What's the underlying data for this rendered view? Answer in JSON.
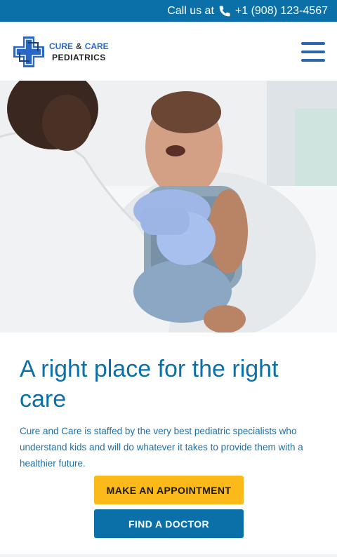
{
  "topbar": {
    "call_label": "Call us at",
    "phone": "+1 (908) 123-4567",
    "icon": "phone-icon"
  },
  "header": {
    "logo": {
      "word1": "CURE",
      "amp": "&",
      "word2": "CARE",
      "word3": "PEDIATRICS",
      "icon": "medical-cross-icon"
    },
    "menu_icon": "hamburger-menu-icon"
  },
  "hero": {
    "image": "doctor applying bandage to smiling toddler's arm"
  },
  "main": {
    "headline": "A right place for the right care",
    "intro": "Cure and Care is staffed by the very best pediatric specialists who understand kids and will do whatever it takes to provide them with a healthier future."
  },
  "buttons": {
    "appointment_label": "MAKE AN APPOINTMENT",
    "doctor_label": "FIND A DOCTOR"
  },
  "colors": {
    "brand_blue": "#0b6fa8",
    "accent_yellow": "#fbb91a",
    "logo_blue": "#2a68c6"
  }
}
